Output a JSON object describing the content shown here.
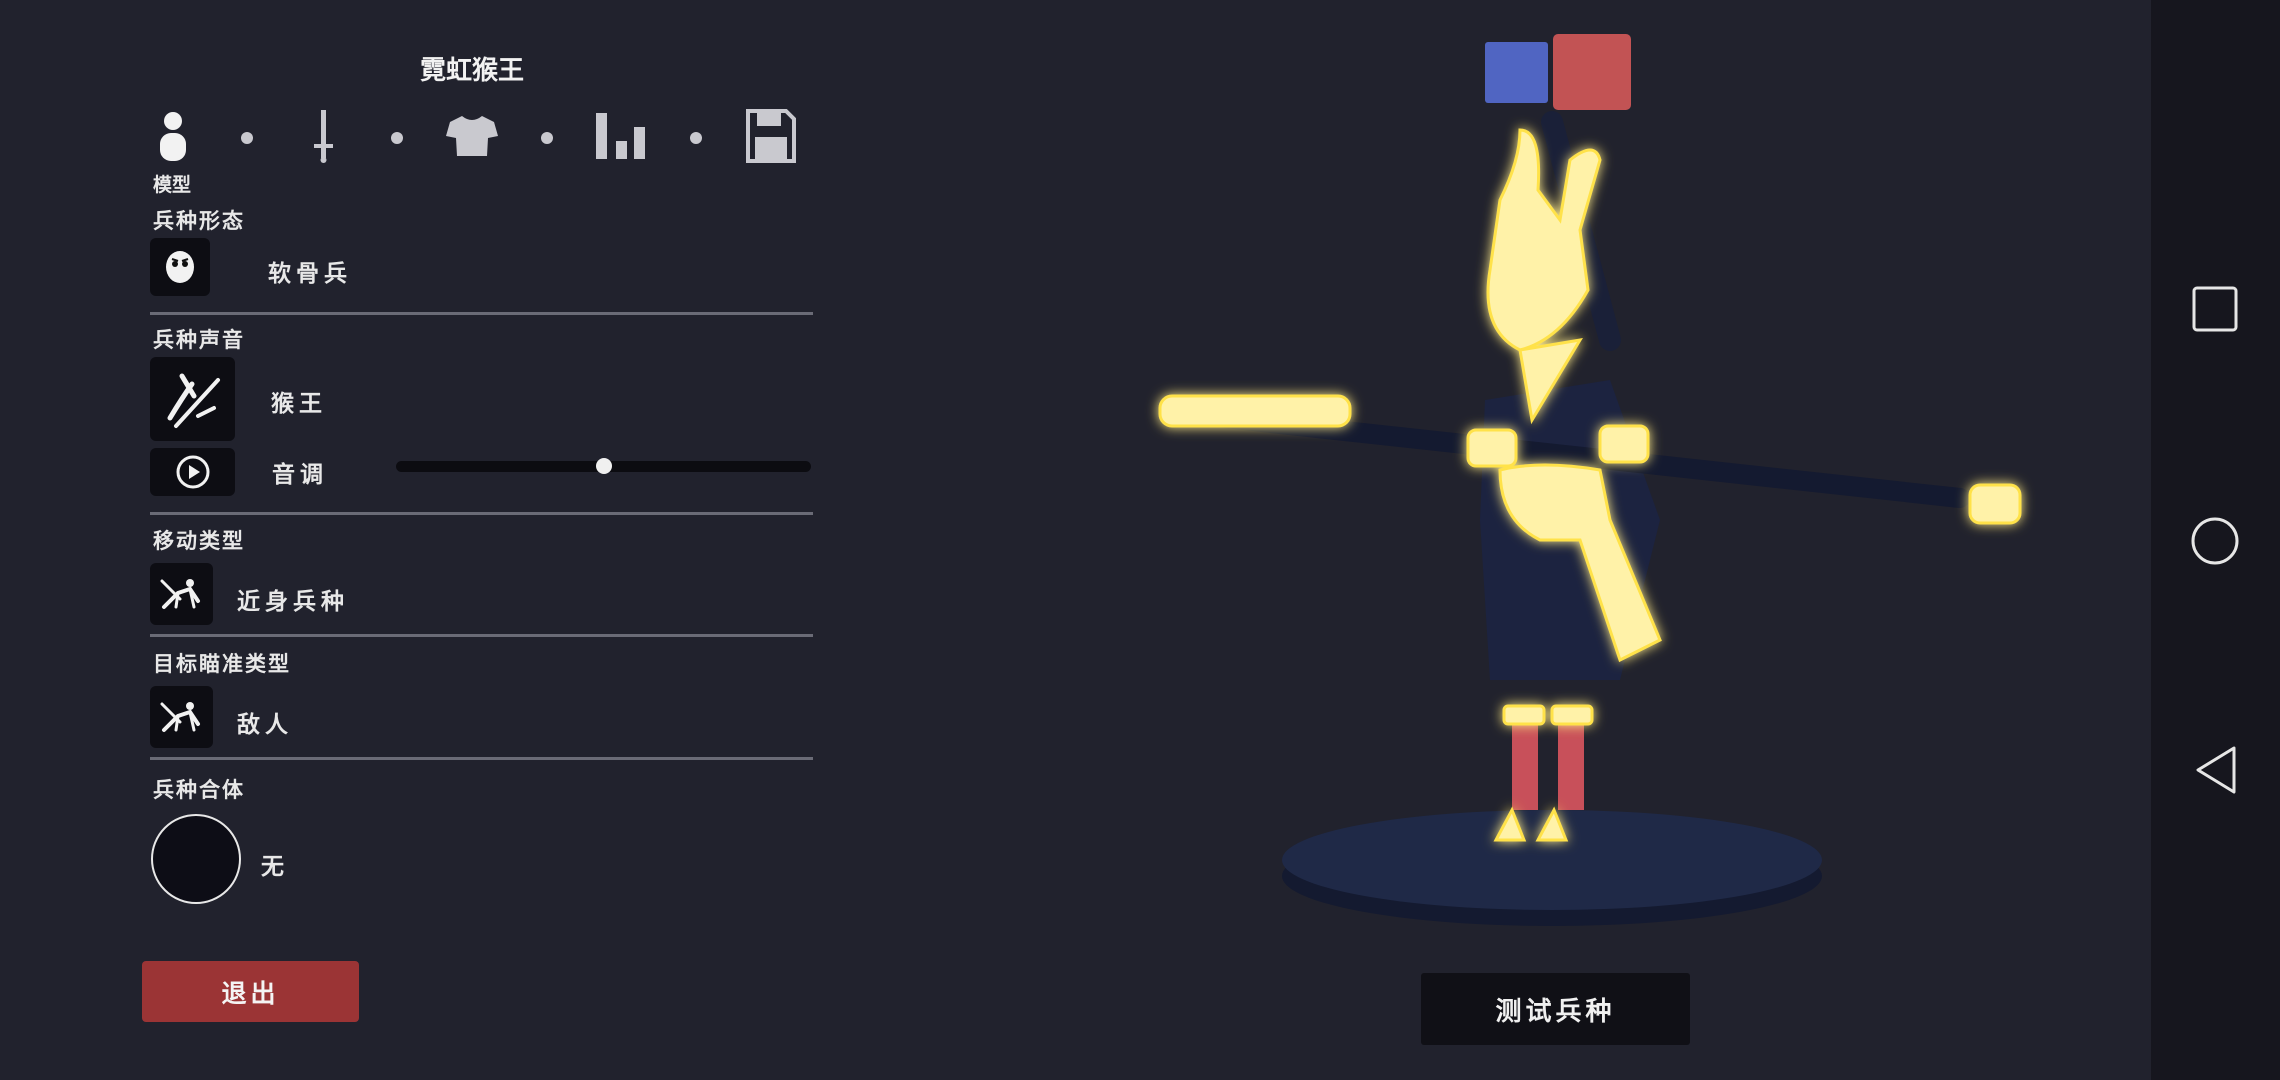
{
  "header": {
    "title": "霓虹猴王"
  },
  "tabs": [
    {
      "label": "模型",
      "icon": "person-icon"
    },
    {
      "icon": "sword-icon"
    },
    {
      "icon": "shirt-icon"
    },
    {
      "icon": "stats-icon"
    },
    {
      "icon": "save-icon"
    }
  ],
  "sections": {
    "form": {
      "label": "兵种形态",
      "value": "软骨兵",
      "icon": "ragdoll-face-icon"
    },
    "sound": {
      "label": "兵种声音",
      "value": "猴王",
      "icon": "voice-slash-icon",
      "pitch_label": "音调",
      "pitch_value": 0.5
    },
    "movement": {
      "label": "移动类型",
      "value": "近身兵种",
      "icon": "melee-unit-icon"
    },
    "target": {
      "label": "目标瞄准类型",
      "value": "敌人",
      "icon": "target-unit-icon"
    },
    "combine": {
      "label": "兵种合体",
      "value": "无"
    }
  },
  "buttons": {
    "exit": "退出",
    "test": "测试兵种"
  },
  "colors": {
    "team_blue": "#5065c2",
    "team_red": "#c25354",
    "exit_button": "#9b3435",
    "background": "#21222d"
  },
  "navbar": {
    "icons": [
      "recents-square-icon",
      "home-circle-icon",
      "back-triangle-icon"
    ]
  }
}
